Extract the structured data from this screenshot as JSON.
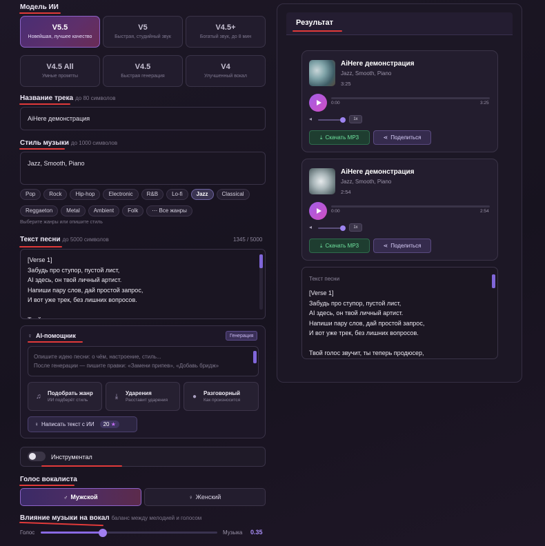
{
  "model": {
    "title": "Модель ИИ",
    "options": [
      {
        "name": "V5.5",
        "desc": "Новейшая, лучшее качество",
        "active": true
      },
      {
        "name": "V5",
        "desc": "Быстрая, студийный звук"
      },
      {
        "name": "V4.5+",
        "desc": "Богатый звук, до 8 мин"
      },
      {
        "name": "V4.5 All",
        "desc": "Умные промпты"
      },
      {
        "name": "V4.5",
        "desc": "Быстрая генерация"
      },
      {
        "name": "V4",
        "desc": "Улучшенный вокал"
      }
    ]
  },
  "track_name": {
    "title": "Название трека",
    "hint": "до 80 символов",
    "value": "AiHere демонстрация"
  },
  "music_style": {
    "title": "Стиль музыки",
    "hint": "до 1000 символов",
    "value": "Jazz, Smooth, Piano",
    "genres_row1": [
      "Pop",
      "Rock",
      "Hip-hop",
      "Electronic",
      "R&B",
      "Lo-fi",
      "Jazz",
      "Classical"
    ],
    "genres_row2": [
      "Reggaeton",
      "Metal",
      "Ambient",
      "Folk"
    ],
    "all_genres": "Все жанры",
    "helper": "Выберите жанры или опишите стиль",
    "active_genre": "Jazz"
  },
  "lyrics": {
    "title": "Текст песни",
    "hint": "до 5000 символов",
    "counter": "1345 / 5000",
    "text": "[Verse 1]\nЗабудь про ступор, пустой лист,\nAI здесь, он твой личный артист.\nНапиши пару слов, дай простой запрос,\nИ вот уже трек, без лишних вопросов.\n\nТвой голос звучит, ты теперь продюсер,"
  },
  "ai_helper": {
    "title": "AI-помощник",
    "badge": "Генерация",
    "placeholder": "Опишите идею песни: о чём, настроение, стиль...\nПосле генерации — пишите правки: «Замени припев», «Добавь бридж»",
    "tiles": [
      {
        "title": "Подобрать жанр",
        "sub": "ИИ подберёт стиль",
        "icon": "music-note-icon"
      },
      {
        "title": "Ударения",
        "sub": "Расставит ударения",
        "icon": "download-icon"
      },
      {
        "title": "Разговорный",
        "sub": "Как произносится",
        "icon": "mic-icon"
      }
    ],
    "write_button": "Написать текст с ИИ",
    "credits": "20"
  },
  "instrumental": {
    "label": "Инструментал",
    "on": false
  },
  "vocalist": {
    "title": "Голос вокалиста",
    "male": "Мужской",
    "female": "Женский",
    "selected": "male"
  },
  "influence": {
    "title": "Влияние музыки на вокал",
    "hint": "баланс между мелодией и голосом",
    "left": "Голос",
    "right": "Музыка",
    "value": "0.35",
    "fraction": 0.35
  },
  "result": {
    "title": "Результат",
    "tracks": [
      {
        "title": "AiHere демонстрация",
        "style": "Jazz, Smooth, Piano",
        "duration": "3:25",
        "current": "0:00",
        "speed": "1x",
        "download": "Скачать MP3",
        "share": "Поделиться"
      },
      {
        "title": "AiHere демонстрация",
        "style": "Jazz, Smooth, Piano",
        "duration": "2:54",
        "current": "0:00",
        "speed": "1x",
        "download": "Скачать MP3",
        "share": "Поделиться"
      }
    ],
    "lyrics_label": "Текст песни",
    "lyrics_text": "[Verse 1]\nЗабудь про ступор, пустой лист,\nAI здесь, он твой личный артист.\nНапиши пару слов, дай простой запрос,\nИ вот уже трек, без лишних вопросов.\n\nТвой голос звучит, ты теперь продюсер,"
  },
  "colors": {
    "accent": "#8a6ae3",
    "underline": "#e23a3a",
    "download": "#6fe39f"
  }
}
